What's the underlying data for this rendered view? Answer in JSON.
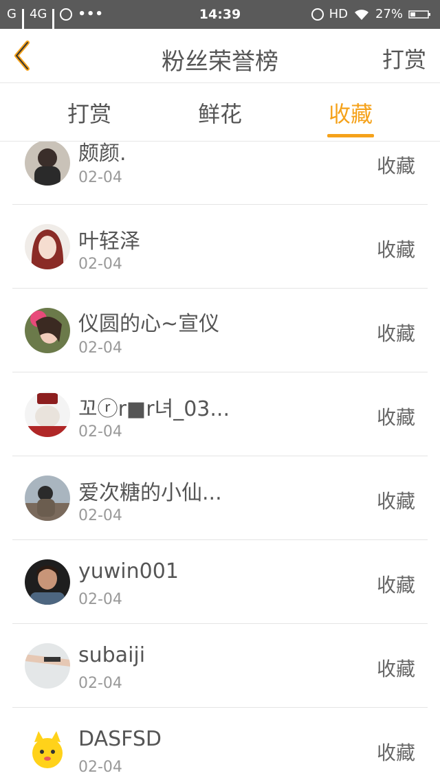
{
  "status_bar": {
    "carrier1": "G",
    "carrier2": "4G",
    "more": "•••",
    "time": "14:39",
    "hd": "HD",
    "battery": "27%"
  },
  "header": {
    "title": "粉丝荣誉榜",
    "right_button": "打赏"
  },
  "tabs": [
    {
      "label": "打赏"
    },
    {
      "label": "鲜花"
    },
    {
      "label": "收藏",
      "active": true
    }
  ],
  "list": [
    {
      "name": "颇颜.",
      "date": "02-04",
      "action": "收藏"
    },
    {
      "name": "叶轻泽",
      "date": "02-04",
      "action": "收藏"
    },
    {
      "name": "仪圆的心~宣仪",
      "date": "02-04",
      "action": "收藏"
    },
    {
      "name": "꼬ⓡr■r녀_03...",
      "date": "02-04",
      "action": "收藏"
    },
    {
      "name": "爱次糖的小仙...",
      "date": "02-04",
      "action": "收藏"
    },
    {
      "name": "yuwin001",
      "date": "02-04",
      "action": "收藏"
    },
    {
      "name": "subaiji",
      "date": "02-04",
      "action": "收藏"
    },
    {
      "name": "DASFSD",
      "date": "02-04",
      "action": "收藏"
    }
  ],
  "colors": {
    "accent": "#f5a21b",
    "status_bar": "#5a5a5a"
  }
}
